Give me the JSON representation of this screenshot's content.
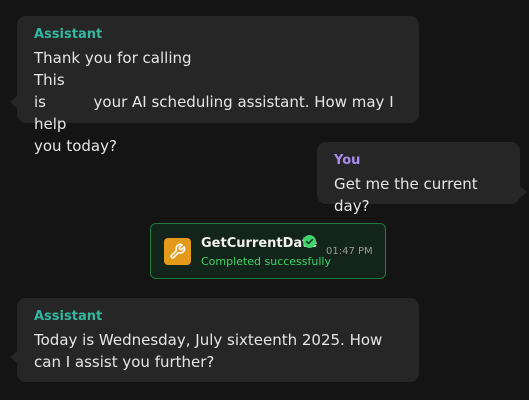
{
  "messages": [
    {
      "sender": "Assistant",
      "line1_start": "Thank you for calling",
      "line1_end": "This",
      "line2_start": "is",
      "line2_end": "your AI scheduling assistant. How may I help",
      "line3": "you today?"
    },
    {
      "sender": "You",
      "text": "Get me the current day?"
    },
    {
      "sender": "Assistant",
      "text": "Today is Wednesday, July sixteenth 2025. How can I assist you further?"
    }
  ],
  "tool_call": {
    "name": "GetCurrentDate",
    "status": "Completed successfully",
    "time": "01:47 PM",
    "icon": "wrench-icon",
    "status_icon": "check-circle-icon"
  },
  "colors": {
    "background": "#141414",
    "bubble": "#262626",
    "assistant_label": "#33b79f",
    "user_label": "#a98cf0",
    "tool_border": "#1f7a3c",
    "tool_status": "#3fd46a",
    "tool_icon_bg": "#e39a1a"
  }
}
